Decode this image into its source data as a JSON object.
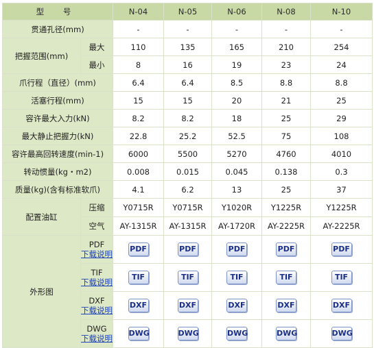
{
  "header": {
    "type_label": "型 号",
    "models": [
      "N-04",
      "N-05",
      "N-06",
      "N-08",
      "N-10"
    ]
  },
  "rows": {
    "through_hole": {
      "label": "贯通孔径(mm)",
      "values": [
        "-",
        "-",
        "-",
        "-",
        "-"
      ]
    },
    "grip_range": {
      "label": "把握范围(mm)",
      "max": {
        "label": "最大",
        "values": [
          "110",
          "135",
          "165",
          "210",
          "254"
        ]
      },
      "min": {
        "label": "最小",
        "values": [
          "8",
          "16",
          "19",
          "23",
          "24"
        ]
      }
    },
    "jaw_stroke": {
      "label": "爪行程（直径）(mm)",
      "values": [
        "6.4",
        "6.4",
        "8.5",
        "8.8",
        "8.8"
      ]
    },
    "piston_stroke": {
      "label": "活塞行程(mm)",
      "values": [
        "15",
        "15",
        "20",
        "21",
        "25"
      ]
    },
    "max_input": {
      "label": "容许最大入力(kN)",
      "values": [
        "8.2",
        "8.2",
        "18",
        "25",
        "29"
      ]
    },
    "max_static_grip": {
      "label": "最大静止把握力(kN)",
      "values": [
        "22.8",
        "25.2",
        "52.5",
        "75",
        "108"
      ]
    },
    "max_speed": {
      "label": "容许最高回转速度(min-1)",
      "values": [
        "6000",
        "5500",
        "5270",
        "4760",
        "4010"
      ]
    },
    "inertia": {
      "label": "转动惯量(kg・m2)",
      "values": [
        "0.008",
        "0.015",
        "0.045",
        "0.138",
        "0.3"
      ]
    },
    "mass": {
      "label": "质量(kg)(含有标准软爪)",
      "values": [
        "4.1",
        "6.2",
        "13",
        "25",
        "37"
      ]
    },
    "cylinder": {
      "label": "配置油缸",
      "hydraulic": {
        "label": "压缩",
        "values": [
          "Y0715R",
          "Y0715R",
          "Y1020R",
          "Y1225R",
          "Y1225R"
        ]
      },
      "pneumatic": {
        "label": "空气",
        "values": [
          "AY-1315R",
          "AY-1315R",
          "AY-1720R",
          "AY-2225R",
          "AY-2225R"
        ]
      }
    },
    "outline": {
      "label": "外形图",
      "formats": [
        {
          "name": "PDF",
          "link": "下载说明",
          "button": "PDF"
        },
        {
          "name": "TIF",
          "link": "下载说明",
          "button": "TIF"
        },
        {
          "name": "DXF",
          "link": "下载说明",
          "button": "DXF"
        },
        {
          "name": "DWG",
          "link": "下载说明",
          "button": "DWG"
        }
      ]
    }
  }
}
